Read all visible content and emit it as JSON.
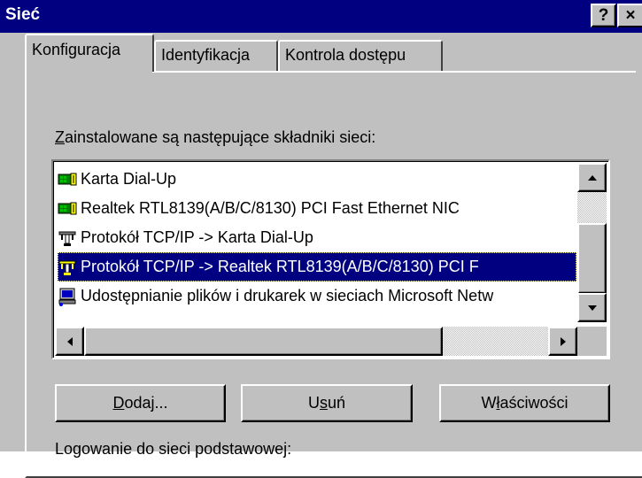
{
  "window": {
    "title": "Sieć",
    "help_label": "?",
    "close_label": "×"
  },
  "tabs": [
    {
      "label": "Konfiguracja",
      "active": true
    },
    {
      "label": "Identyfikacja",
      "active": false
    },
    {
      "label": "Kontrola dostępu",
      "active": false
    }
  ],
  "components": {
    "label_accel": "Z",
    "label_rest": "ainstalowane są następujące składniki sieci:",
    "items": [
      {
        "label": "Karta Dial-Up",
        "icon": "network-adapter-icon",
        "selected": false
      },
      {
        "label": "Realtek RTL8139(A/B/C/8130) PCI Fast Ethernet NIC",
        "icon": "network-adapter-icon",
        "selected": false
      },
      {
        "label": "Protokół TCP/IP -> Karta Dial-Up",
        "icon": "protocol-icon",
        "selected": false
      },
      {
        "label": "Protokół TCP/IP -> Realtek RTL8139(A/B/C/8130) PCI F",
        "icon": "protocol-icon",
        "selected": true
      },
      {
        "label": "Udostępnianie plików i drukarek w sieciach Microsoft Netw",
        "icon": "file-printer-sharing-icon",
        "selected": false
      }
    ]
  },
  "buttons": {
    "add_accel": "D",
    "add_rest": "odaj...",
    "remove_pre": "U",
    "remove_accel": "s",
    "remove_post": "uń",
    "props_pre": "W",
    "props_accel": "ł",
    "props_post": "aściwości"
  },
  "primary_logon_label": "Logowanie do sieci podstawowej:"
}
